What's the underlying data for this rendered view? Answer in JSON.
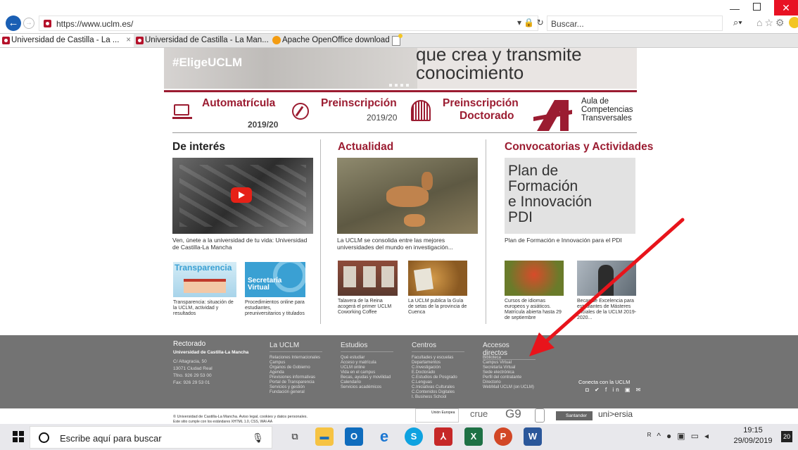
{
  "browser": {
    "url": "https://www.uclm.es/",
    "search_placeholder": "Buscar...",
    "tabs": [
      {
        "label": "Universidad de Castilla - La ...",
        "close": "×"
      },
      {
        "label": "Universidad de Castilla - La Man..."
      },
      {
        "label": "Apache OpenOffice download |..."
      }
    ]
  },
  "hero": {
    "tag": "#EligeUCLM",
    "line1": "que crea y transmite",
    "line2": "conocimiento"
  },
  "quick_links": [
    {
      "label": "Automatrícula",
      "year": "2019/20"
    },
    {
      "label": "Preinscripción",
      "year": "2019/20"
    },
    {
      "label": "Preinscripción",
      "sub": "Doctorado"
    },
    {
      "l1": "Aula de",
      "l2": "Competencias",
      "l3": "Transversales"
    }
  ],
  "sections": {
    "interes": {
      "title": "De interés",
      "caption": "Ven, únete a la universidad de tu vida: Universidad de Castilla-La Mancha",
      "small1_title": "Transparencia",
      "small1_caption": "Transparencia: situación de la UCLM, actividad y resultados",
      "small2_title": "Secretaría Virtual",
      "small2_caption": "Procedimientos online para estudiantes, preuniversitarios y titulados"
    },
    "actualidad": {
      "title": "Actualidad",
      "caption": "La UCLM se consolida entre las mejores universidades del mundo en investigación...",
      "small1_caption": "Talavera de la Reina acogerá el primer UCLM Coworking Coffee",
      "small2_caption": "La UCLM publica la Guía de setas de la provincia de Cuenca"
    },
    "convocatorias": {
      "title_a": "Convocatorias",
      "title_b": "y Actividades",
      "banner_l1": "Plan de",
      "banner_l2": "Formación",
      "banner_l3": "e Innovación",
      "banner_l4": "PDI",
      "caption": "Plan de Formación e Innovación para el PDI",
      "small1_caption": "Cursos de idiomas europeos y asiáticos. Matrícula abierta hasta 29 de septiembre",
      "small2_caption": "Becas de Excelencia para estudiantes de Másteres oficiales de la UCLM 2019-2020..."
    }
  },
  "footer": {
    "rectorado": {
      "title": "Rectorado",
      "name": "Universidad de Castilla-La Mancha",
      "lines": [
        "C/ Altagracia, 50",
        "13071 Ciudad Real",
        "Tfno. 926 29 53 00",
        "Fax: 926 29 53 01"
      ]
    },
    "uclm": {
      "title": "La UCLM",
      "links": [
        "Relaciones Internacionales",
        "Campus",
        "Órganos de Gobierno",
        "Agenda",
        "Previsiones informativas",
        "Portal de Transparencia",
        "Servicios y gestión",
        "Fundación general"
      ]
    },
    "estudios": {
      "title": "Estudios",
      "links": [
        "Qué estudiar",
        "Acceso y matrícula",
        "UCLM online",
        "Vida en el campus",
        "Becas, ayudas y movilidad",
        "Calendario",
        "Servicios académicos"
      ]
    },
    "centros": {
      "title": "Centros",
      "links": [
        "Facultades y escuelas",
        "Departamentos",
        "C.Investigación",
        "E.Doctorado",
        "C.Estudios de Posgrado",
        "C.Lenguas",
        "C.Iniciativas Culturales",
        "C.Contenidos Digitales",
        "I. Business School"
      ]
    },
    "accesos": {
      "title": "Accesos directos",
      "links": [
        "Biblioteca",
        "Campus Virtual",
        "Secretaría Virtual",
        "Sede electrónica",
        "Perfil del contratante",
        "Directorio",
        "WebMail UCLM (on UCLM)"
      ]
    },
    "social": {
      "title": "Conecta con la UCLM",
      "icons": "◘ ✔ f in ▣ ✉"
    }
  },
  "legal": {
    "line1": "© Universidad de Castilla-La Mancha. Aviso legal, cookies y datos personales.",
    "line2": "Este sitio cumple con los estándares XHTML 1.0, CSS, WAI-AA",
    "logos": [
      "Unión Europea",
      "crue",
      "G9",
      "Santander",
      "uni>ersia"
    ]
  },
  "taskbar": {
    "search": "Escribe aquí para buscar",
    "time": "19:15",
    "date": "29/09/2019",
    "notif": "20"
  },
  "colors": {
    "accent": "#9b1c31",
    "footer": "#737373",
    "arrow": "#e8141b"
  }
}
